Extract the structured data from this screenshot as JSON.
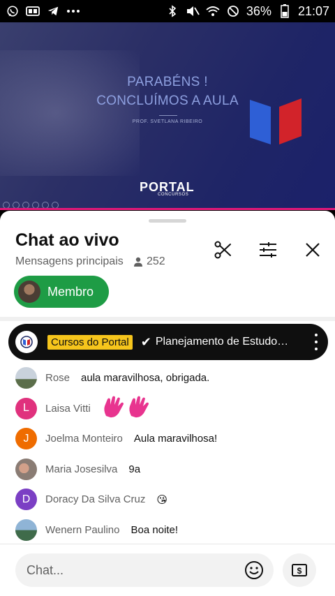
{
  "status_bar": {
    "battery": "36%",
    "time": "21:07",
    "left_icons": [
      "whatsapp-icon",
      "rec-icon",
      "telegram-icon",
      "more-dots-icon"
    ],
    "right_icons": [
      "bluetooth-icon",
      "mute-icon",
      "wifi-icon",
      "no-disturb-icon",
      "battery-icon"
    ]
  },
  "video": {
    "slide_title_line1": "PARABÉNS !",
    "slide_title_line2": "CONCLUÍMOS A AULA",
    "slide_prof": "PROF. SVETLANA RIBEIRO",
    "logo_text": "PORTAL",
    "logo_sub": "CONCURSOS"
  },
  "chat": {
    "title": "Chat ao vivo",
    "subtitle": "Mensagens principais",
    "viewer_count": "252",
    "member_button": "Membro",
    "pinned": {
      "badge": "Cursos do Portal",
      "text": "Planejamento de Estudo…"
    },
    "messages": [
      {
        "author": "Rose",
        "text": "aula maravilhosa, obrigada.",
        "initial": "",
        "color": "#8c9aa5"
      },
      {
        "author": "Laisa Vitti",
        "text": "",
        "initial": "L",
        "color": "#e0317d"
      },
      {
        "author": "Joelma Monteiro",
        "text": "Aula maravilhosa!",
        "initial": "J",
        "color": "#ef6c00"
      },
      {
        "author": "Maria Josesilva",
        "text": "9a",
        "initial": "",
        "color": "#b5a89a"
      },
      {
        "author": "Doracy Da Silva Cruz",
        "text": "😘",
        "initial": "D",
        "color": "#7b3fc4"
      },
      {
        "author": "Wenern Paulino",
        "text": "Boa noite!",
        "initial": "",
        "color": "#6b93b8"
      }
    ],
    "input_placeholder": "Chat...",
    "colors": {
      "accent_green": "#1e9c45",
      "progress_pink": "#e4187a",
      "badge_yellow": "#f6c51c"
    }
  }
}
